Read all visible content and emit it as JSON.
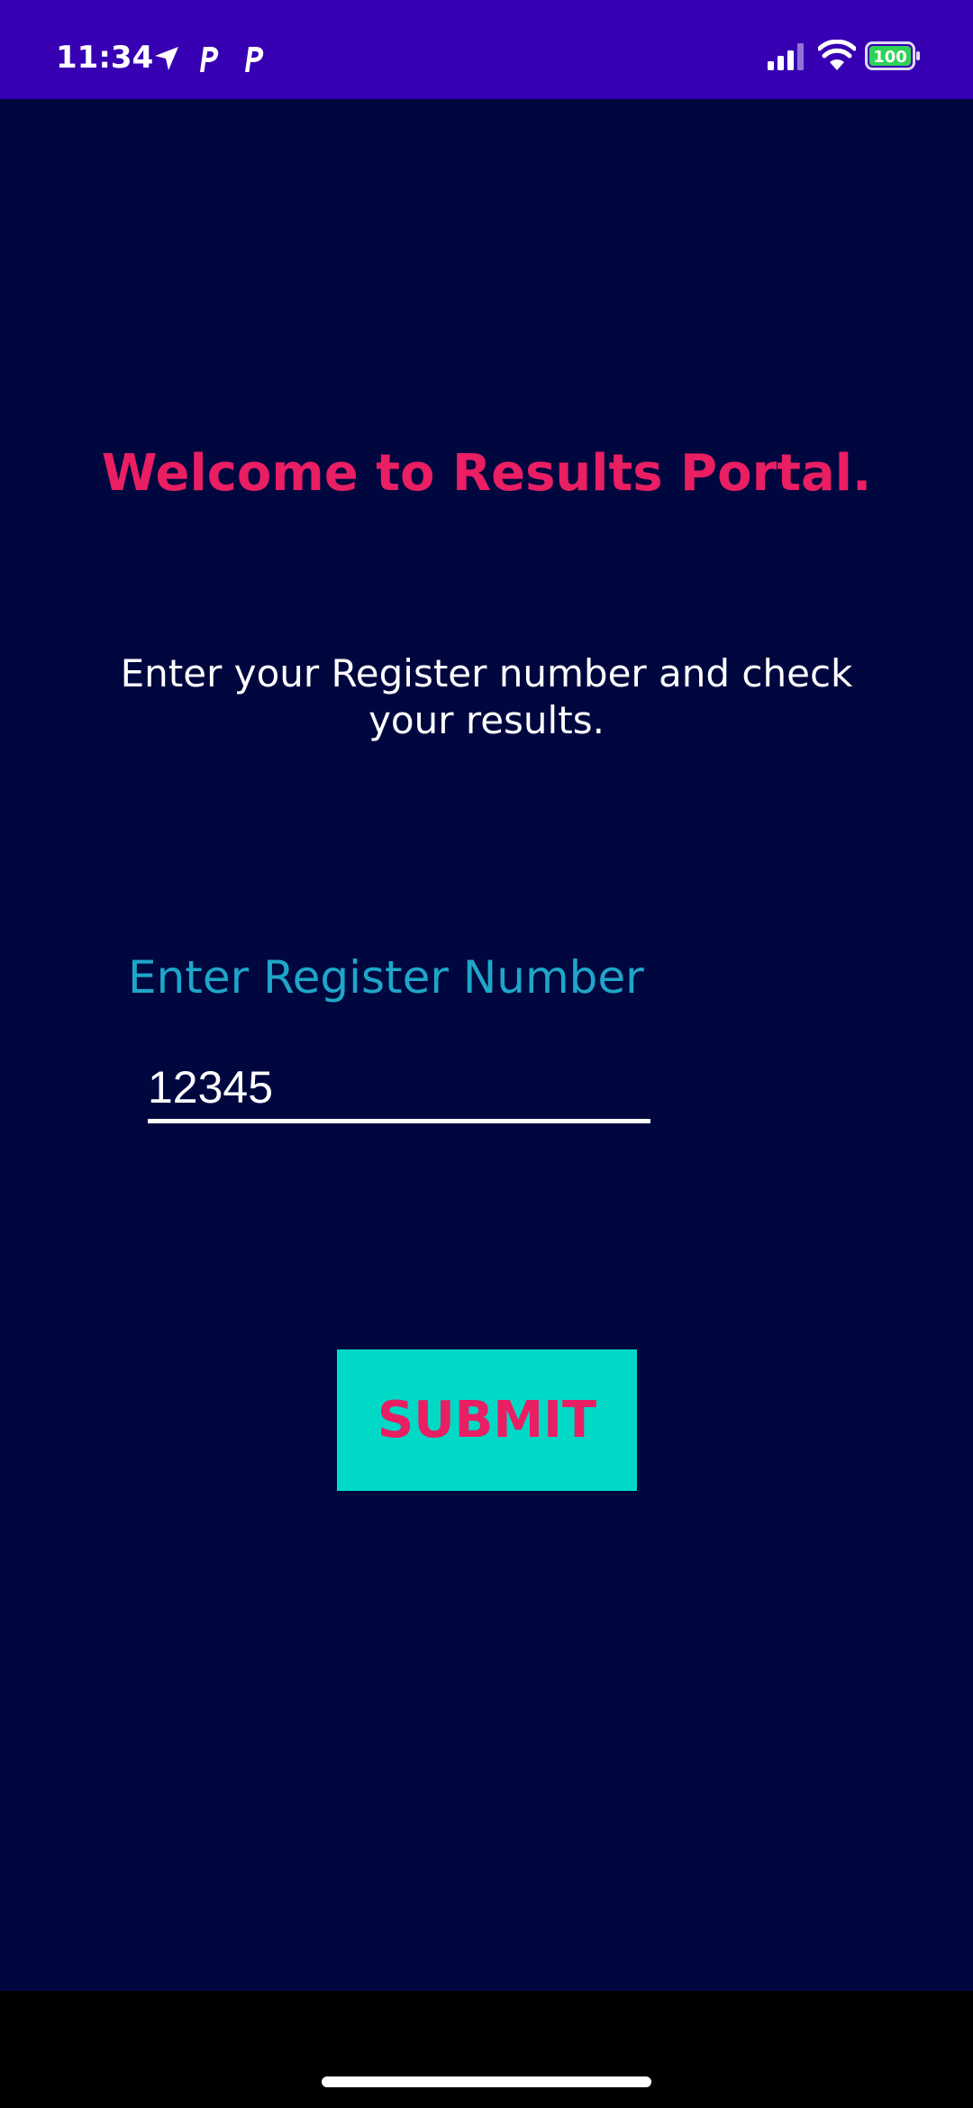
{
  "status_bar": {
    "time": "11:34",
    "battery_level": "100",
    "icons": [
      "location-arrow-icon",
      "parking-app-icon",
      "parking-app-icon",
      "signal-icon",
      "wifi-icon",
      "battery-icon"
    ],
    "background_color": "#3700b3"
  },
  "main": {
    "title": "Welcome to Results Portal.",
    "instruction": "Enter your Register number and check your results.",
    "field_label": "Enter Register Number",
    "register_input_value": "12345",
    "submit_label": "SUBMIT",
    "background_color": "#00073f",
    "title_color": "#e91e63",
    "label_color": "#1ea6c8",
    "button_color": "#00d9c6"
  }
}
